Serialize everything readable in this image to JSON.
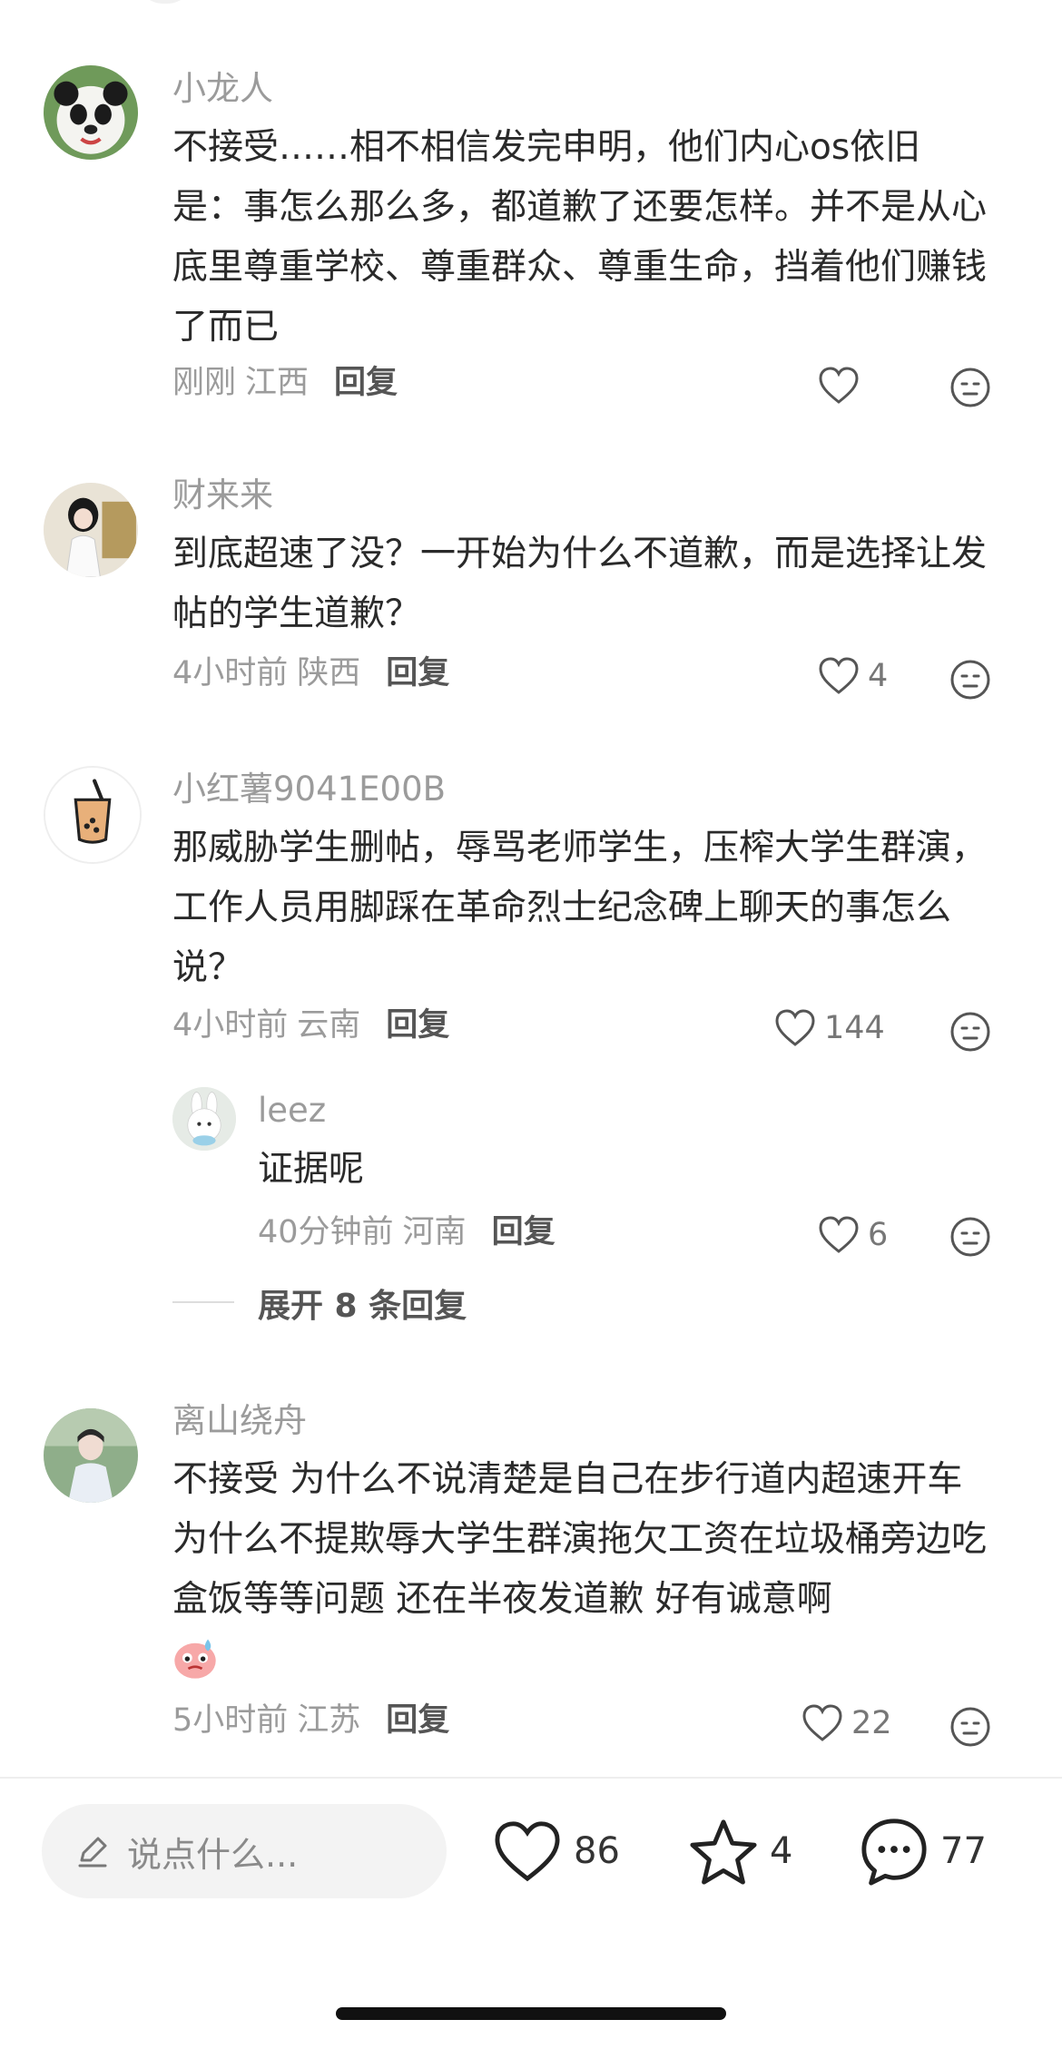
{
  "comments": [
    {
      "user": "小龙人",
      "text": "不接受……相不相信发完申明，他们内心os依旧是：事怎么那么多，都道歉了还要怎样。并不是从心底里尊重学校、尊重群众、尊重生命，挡着他们赚钱了而已",
      "time": "刚刚",
      "location": "江西",
      "reply": "回复",
      "likes": "",
      "avatar": "panda"
    },
    {
      "user": "财来来",
      "text": "到底超速了没？一开始为什么不道歉，而是选择让发帖的学生道歉？",
      "time": "4小时前",
      "location": "陕西",
      "reply": "回复",
      "likes": "4",
      "avatar": "girl"
    },
    {
      "user": "小红薯9041E00B",
      "text": "那威胁学生删帖，辱骂老师学生，压榨大学生群演，工作人员用脚踩在革命烈士纪念碑上聊天的事怎么说？",
      "time": "4小时前",
      "location": "云南",
      "reply": "回复",
      "likes": "144",
      "avatar": "bubble-tea"
    },
    {
      "user": "离山绕舟",
      "text": "不接受 为什么不说清楚是自己在步行道内超速开车 为什么不提欺辱大学生群演拖欠工资在垃圾桶旁边吃盒饭等等问题 还在半夜发道歉 好有诚意啊",
      "time": "5小时前",
      "location": "江苏",
      "reply": "回复",
      "likes": "22",
      "avatar": "portrait"
    }
  ],
  "sub_reply": {
    "user": "leez",
    "text": "证据呢",
    "time": "40分钟前",
    "location": "河南",
    "reply": "回复",
    "likes": "6",
    "avatar": "bunny"
  },
  "expand_label": "展开 8 条回复",
  "bottom_bar": {
    "input_placeholder": "说点什么...",
    "like_count": "86",
    "star_count": "4",
    "comment_count": "77"
  },
  "icons": [
    "heart-icon",
    "face-icon",
    "pencil-icon",
    "star-icon",
    "comment-bubble-icon"
  ]
}
